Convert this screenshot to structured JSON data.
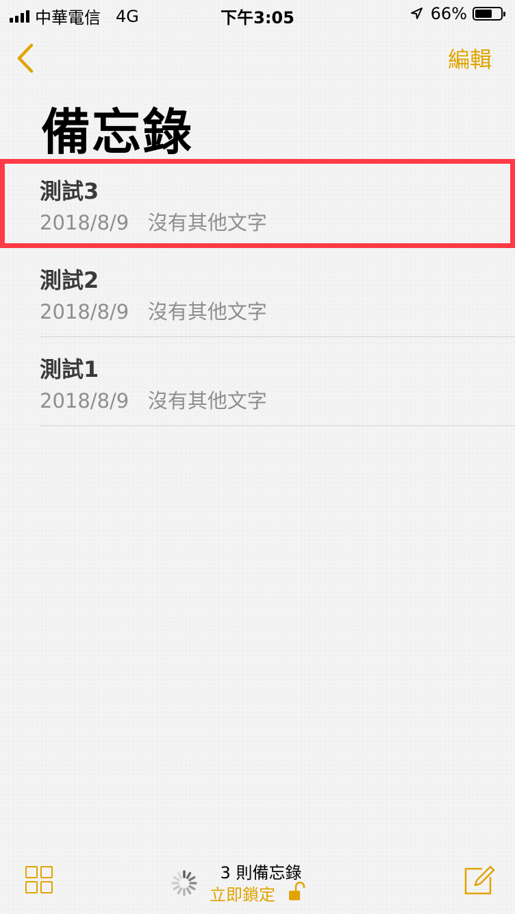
{
  "status_bar": {
    "carrier": "中華電信",
    "network": "4G",
    "time": "下午3:05",
    "battery_percent": "66%",
    "battery_level": 0.66
  },
  "nav": {
    "back_icon": "chevron-left-icon",
    "edit_label": "編輯",
    "accent_color": "#e0a400"
  },
  "page": {
    "title": "備忘錄"
  },
  "notes": [
    {
      "title": "測試3",
      "date": "2018/8/9",
      "preview": "沒有其他文字",
      "highlighted": true
    },
    {
      "title": "測試2",
      "date": "2018/8/9",
      "preview": "沒有其他文字",
      "highlighted": false
    },
    {
      "title": "測試1",
      "date": "2018/8/9",
      "preview": "沒有其他文字",
      "highlighted": false
    }
  ],
  "toolbar": {
    "count_label": "3 則備忘錄",
    "lock_label": "立即鎖定",
    "gallery_icon": "grid-icon",
    "compose_icon": "compose-icon",
    "lock_icon": "unlocked-padlock-icon",
    "spinner_icon": "spinner-icon"
  },
  "highlight_color": "#ff3b47"
}
